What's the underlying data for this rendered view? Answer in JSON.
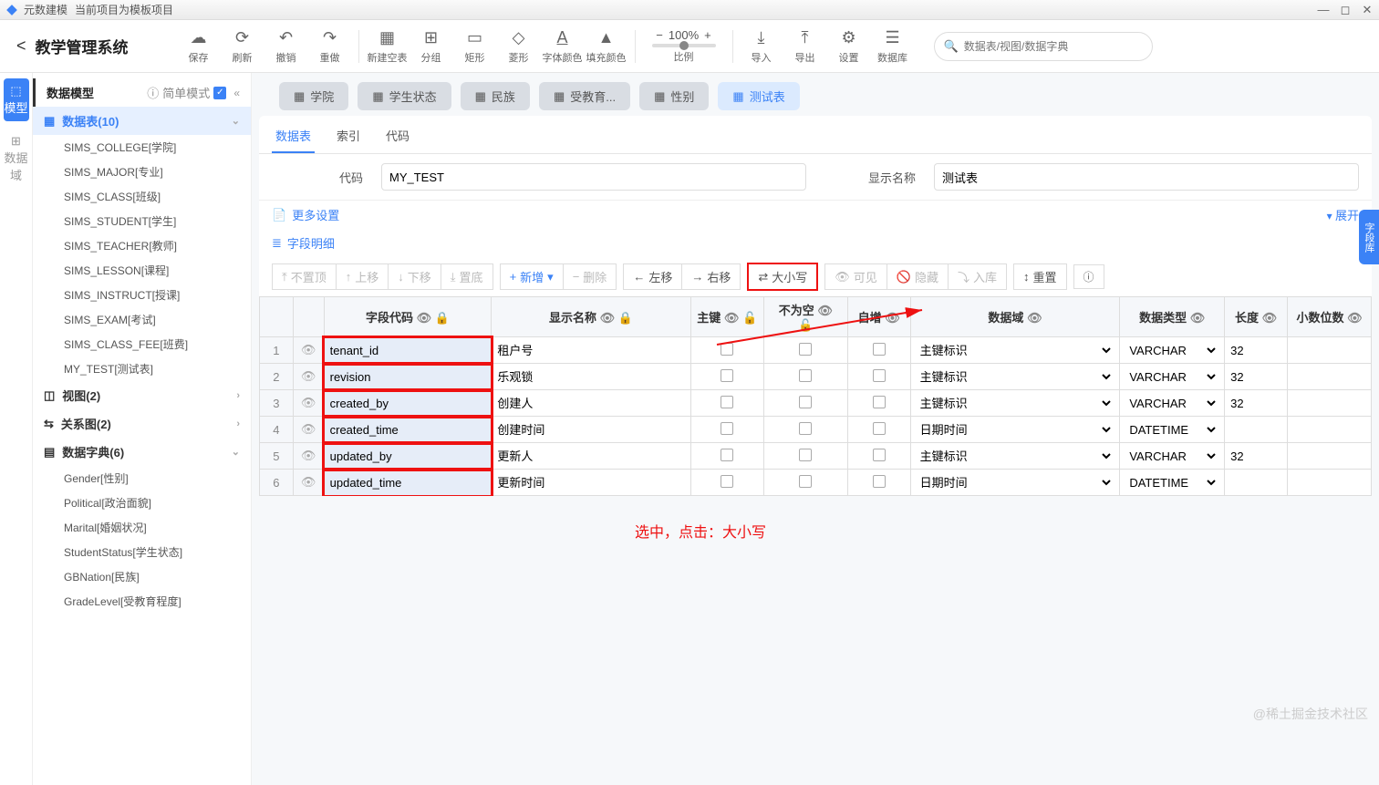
{
  "titlebar": {
    "app": "元数建模",
    "project": "当前项目为模板项目"
  },
  "system_title": "教学管理系统",
  "toolbar": {
    "save": "保存",
    "refresh": "刷新",
    "undo": "撤销",
    "redo": "重做",
    "newTable": "新建空表",
    "split": "分组",
    "rect": "矩形",
    "diamond": "菱形",
    "fontColor": "字体颜色",
    "fillColor": "填充颜色",
    "zoom": "100%",
    "zoomLabel": "比例",
    "import": "导入",
    "export": "导出",
    "settings": "设置",
    "db": "数据库"
  },
  "search": {
    "placeholder": "数据表/视图/数据字典"
  },
  "rail": {
    "model": "模型",
    "domain": "数据域"
  },
  "sidebar": {
    "title": "数据模型",
    "mode": "简单模式",
    "groups": {
      "tables": {
        "label": "数据表(10)",
        "items": [
          "SIMS_COLLEGE[学院]",
          "SIMS_MAJOR[专业]",
          "SIMS_CLASS[班级]",
          "SIMS_STUDENT[学生]",
          "SIMS_TEACHER[教师]",
          "SIMS_LESSON[课程]",
          "SIMS_INSTRUCT[授课]",
          "SIMS_EXAM[考试]",
          "SIMS_CLASS_FEE[班费]",
          "MY_TEST[测试表]"
        ]
      },
      "views": {
        "label": "视图(2)"
      },
      "relations": {
        "label": "关系图(2)"
      },
      "dicts": {
        "label": "数据字典(6)",
        "items": [
          "Gender[性别]",
          "Political[政治面貌]",
          "Marital[婚姻状况]",
          "StudentStatus[学生状态]",
          "GBNation[民族]",
          "GradeLevel[受教育程度]"
        ]
      }
    }
  },
  "tabs": [
    "学院",
    "学生状态",
    "民族",
    "受教育...",
    "性别",
    "测试表"
  ],
  "activeTab": "测试表",
  "subtabs": [
    "数据表",
    "索引",
    "代码"
  ],
  "form": {
    "codeLabel": "代码",
    "code": "MY_TEST",
    "nameLabel": "显示名称",
    "name": "测试表"
  },
  "more": "更多设置",
  "expand": "展开",
  "detail": "字段明细",
  "fieldTools": {
    "top": "不置顶",
    "up": "上移",
    "down": "下移",
    "bottom": "置底",
    "add": "新增",
    "del": "删除",
    "left": "左移",
    "right": "右移",
    "case": "大小写",
    "visible": "可见",
    "hide": "隐藏",
    "store": "入库",
    "reset": "重置"
  },
  "columns": {
    "code": "字段代码",
    "name": "显示名称",
    "pk": "主键",
    "notnull": "不为空",
    "auto": "自增",
    "domain": "数据域",
    "type": "数据类型",
    "len": "长度",
    "scale": "小数位数"
  },
  "rows": [
    {
      "n": 1,
      "code": "tenant_id",
      "name": "租户号",
      "domain": "主键标识",
      "type": "VARCHAR",
      "len": "32",
      "scale": ""
    },
    {
      "n": 2,
      "code": "revision",
      "name": "乐观锁",
      "domain": "主键标识",
      "type": "VARCHAR",
      "len": "32",
      "scale": ""
    },
    {
      "n": 3,
      "code": "created_by",
      "name": "创建人",
      "domain": "主键标识",
      "type": "VARCHAR",
      "len": "32",
      "scale": ""
    },
    {
      "n": 4,
      "code": "created_time",
      "name": "创建时间",
      "domain": "日期时间",
      "type": "DATETIME",
      "len": "",
      "scale": ""
    },
    {
      "n": 5,
      "code": "updated_by",
      "name": "更新人",
      "domain": "主键标识",
      "type": "VARCHAR",
      "len": "32",
      "scale": ""
    },
    {
      "n": 6,
      "code": "updated_time",
      "name": "更新时间",
      "domain": "日期时间",
      "type": "DATETIME",
      "len": "",
      "scale": ""
    }
  ],
  "annotation": "选中，点击：大小写",
  "watermark": "@稀土掘金技术社区",
  "rightPanel": "字段库"
}
